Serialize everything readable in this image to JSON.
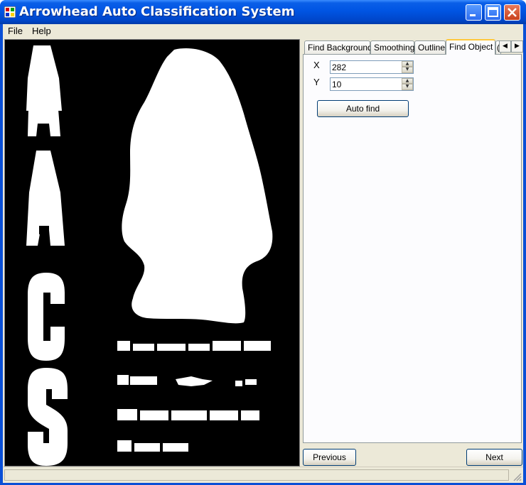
{
  "window": {
    "title": "Arrowhead Auto Classification System",
    "icon": "app-icon",
    "controls": [
      "minimize-icon",
      "maximize-icon",
      "close-icon"
    ]
  },
  "menu": {
    "items": [
      "File",
      "Help"
    ]
  },
  "image": {
    "logo_letters": "AACS",
    "caption_lines": [
      "Archaeological",
      "Auto Classification",
      "Classification",
      "System"
    ]
  },
  "tabs": {
    "items": [
      "Find Background",
      "Smoothing",
      "Outline",
      "Find Object",
      "("
    ],
    "active": "Find Object"
  },
  "find_object": {
    "x_label": "X",
    "x_value": "282",
    "y_label": "Y",
    "y_value": "10",
    "auto_find_label": "Auto find"
  },
  "nav": {
    "previous_label": "Previous",
    "next_label": "Next"
  },
  "colors": {
    "title_blue": "#0054e3",
    "face": "#ece9d8",
    "active_tab_accent": "#ffc83c"
  }
}
